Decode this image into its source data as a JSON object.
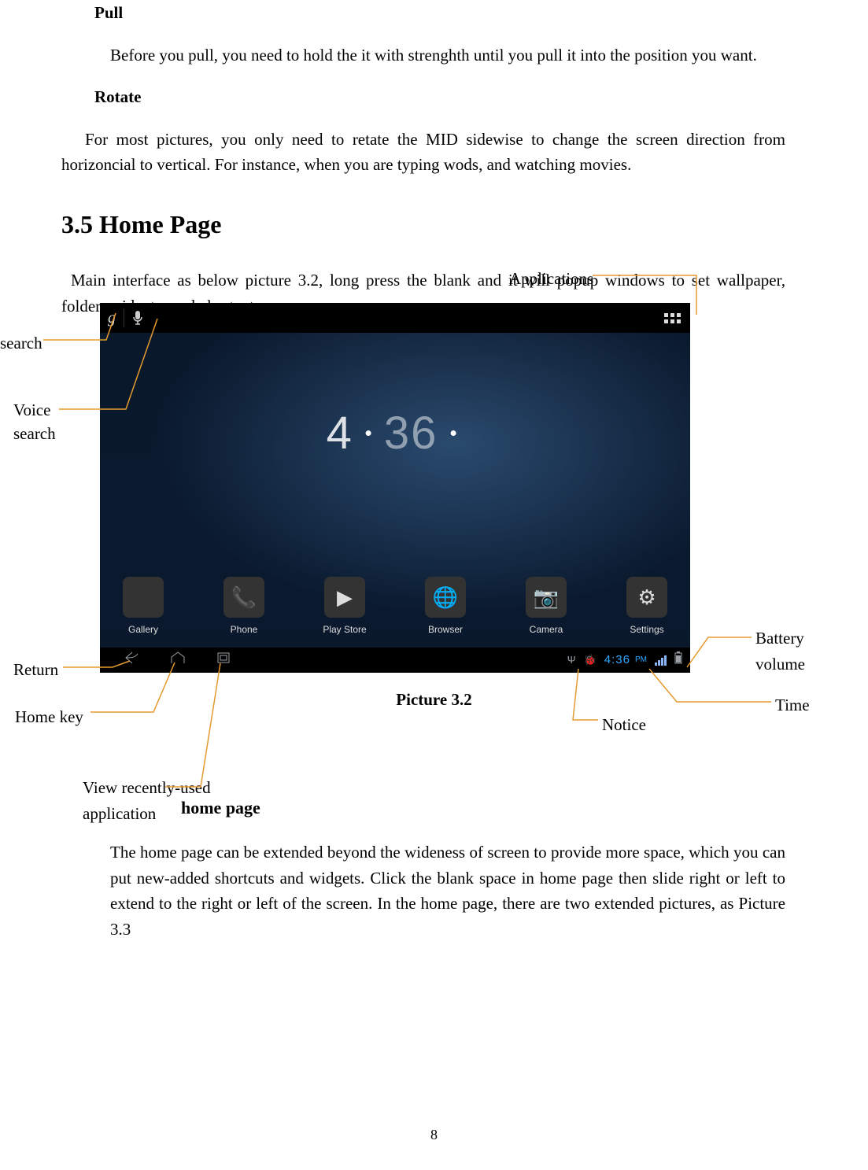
{
  "page_number": "8",
  "sections": {
    "pull_heading": "Pull",
    "pull_body": "Before you pull, you need to hold the it with strenghth until you pull it into the position you want.",
    "rotate_heading": "Rotate",
    "rotate_body": "For most pictures, you only need to retate the MID sidewise to change the screen direction from horizoncial to vertical. For instance, when you are typing wods, and watching movies.",
    "section_title": "3.5 Home Page",
    "section_intro": "Main interface as below picture 3.2, long press the blank and it will popup windows to set wallpaper, folder, widgets, and shortcut.",
    "figure_caption": "Picture 3.2",
    "homepage_heading": "home page",
    "homepage_body": "The home page can be extended beyond the wideness of screen to provide more space, which you can put new-added shortcuts and widgets. Click the blank space in home page then slide right or left to extend to the right or left of the screen. In the home page, there are two extended pictures, as Picture 3.3"
  },
  "callouts": {
    "applications": "Applications",
    "search": "search",
    "voice_search_l1": "Voice",
    "voice_search_l2": "search",
    "return": "Return",
    "home_key": "Home key",
    "recent_l1": "View recently-used",
    "recent_l2": "application",
    "notice": "Notice",
    "time": "Time",
    "battery_l1": "Battery",
    "battery_l2": "volume"
  },
  "screenshot": {
    "searchbar": {
      "google_glyph": "g",
      "mic_glyph": "🎤"
    },
    "clock": {
      "hour": "4",
      "minute": "36"
    },
    "dock": [
      {
        "name": "gallery",
        "label": "Gallery",
        "icon_class": "ico-gallery",
        "glyph": ""
      },
      {
        "name": "phone",
        "label": "Phone",
        "icon_class": "ico-phone",
        "glyph": "📞"
      },
      {
        "name": "play",
        "label": "Play Store",
        "icon_class": "ico-play",
        "glyph": "▶"
      },
      {
        "name": "browser",
        "label": "Browser",
        "icon_class": "ico-browser",
        "glyph": "🌐"
      },
      {
        "name": "camera",
        "label": "Camera",
        "icon_class": "ico-camera",
        "glyph": "📷"
      },
      {
        "name": "settings",
        "label": "Settings",
        "icon_class": "ico-settings",
        "glyph": "⚙"
      }
    ],
    "statusbar": {
      "time": "4:36",
      "pm": "PM"
    }
  }
}
